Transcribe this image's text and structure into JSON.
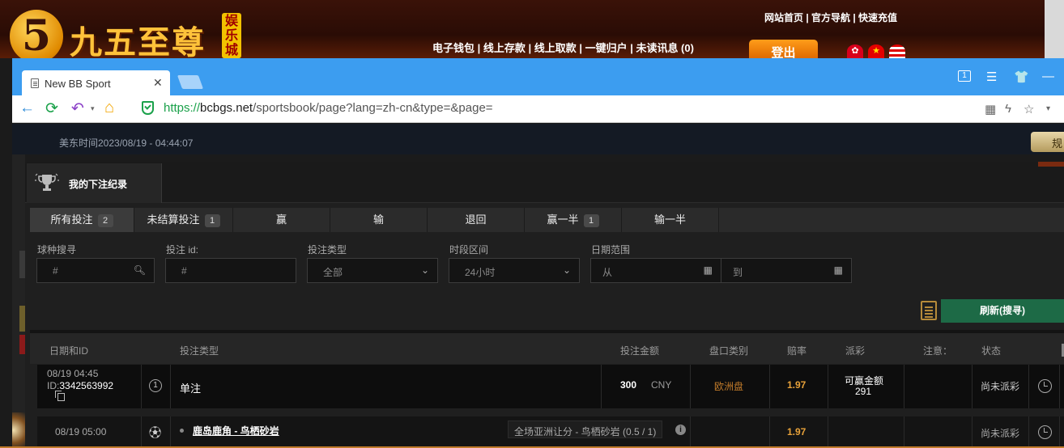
{
  "site": {
    "logo_mark": "5",
    "brand": "九五至尊",
    "tag": "娱乐城",
    "top_links": "网站首页 | 官方导航 | 快速充值",
    "nav": "电子钱包 | 线上存款 | 线上取款 | 一键归户 | 未读讯息 (0)",
    "login_label": "登出",
    "flags": [
      "flag-hk-icon",
      "flag-cn-icon",
      "flag-us-icon"
    ]
  },
  "browser": {
    "tab_title": "New BB Sport",
    "tab_count": "1",
    "url_scheme": "https://",
    "url_host": "bcbgs.net",
    "url_path": "/sportsbook/page?lang=zh-cn&type=&page="
  },
  "sportsbook": {
    "time": "美东时间2023/08/19 - 04:44:07",
    "rules_label": "规",
    "panel_title": "我的下注纪录",
    "tabs": [
      {
        "label": "所有投注",
        "count": "2"
      },
      {
        "label": "未结算投注",
        "count": "1"
      },
      {
        "label": "赢",
        "count": ""
      },
      {
        "label": "输",
        "count": ""
      },
      {
        "label": "退回",
        "count": ""
      },
      {
        "label": "赢一半",
        "count": "1"
      },
      {
        "label": "输一半",
        "count": ""
      }
    ],
    "filters": {
      "sport_label": "球种搜寻",
      "sport_placeholder": "#",
      "betid_label": "投注 id:",
      "betid_placeholder": "#",
      "bettype_label": "投注类型",
      "bettype_value": "全部",
      "period_label": "时段区间",
      "period_value": "24小时",
      "date_label": "日期范围",
      "date_from": "从",
      "date_to": "到"
    },
    "refresh_label": "刷新(搜寻)",
    "columns": [
      "日期和ID",
      "投注类型",
      "投注金额",
      "盘口类别",
      "赔率",
      "派彩",
      "注意：",
      "状态"
    ],
    "rows": [
      {
        "date": "08/19 04:45",
        "id_prefix": "ID:",
        "id": "3342563992",
        "num": "1",
        "type": "单注",
        "stake": "300",
        "currency": "CNY",
        "market": "欧洲盘",
        "odds": "1.97",
        "payout_label": "可赢金额",
        "payout_value": "291",
        "status": "尚未派彩"
      },
      {
        "date": "08/19 05:00",
        "match": "鹿岛鹿角 - 鸟栖砂岩",
        "bet": "全场亚洲让分 - 鸟栖砂岩 (0.5 / 1)",
        "odds": "1.97",
        "status": "尚未派彩"
      }
    ]
  }
}
